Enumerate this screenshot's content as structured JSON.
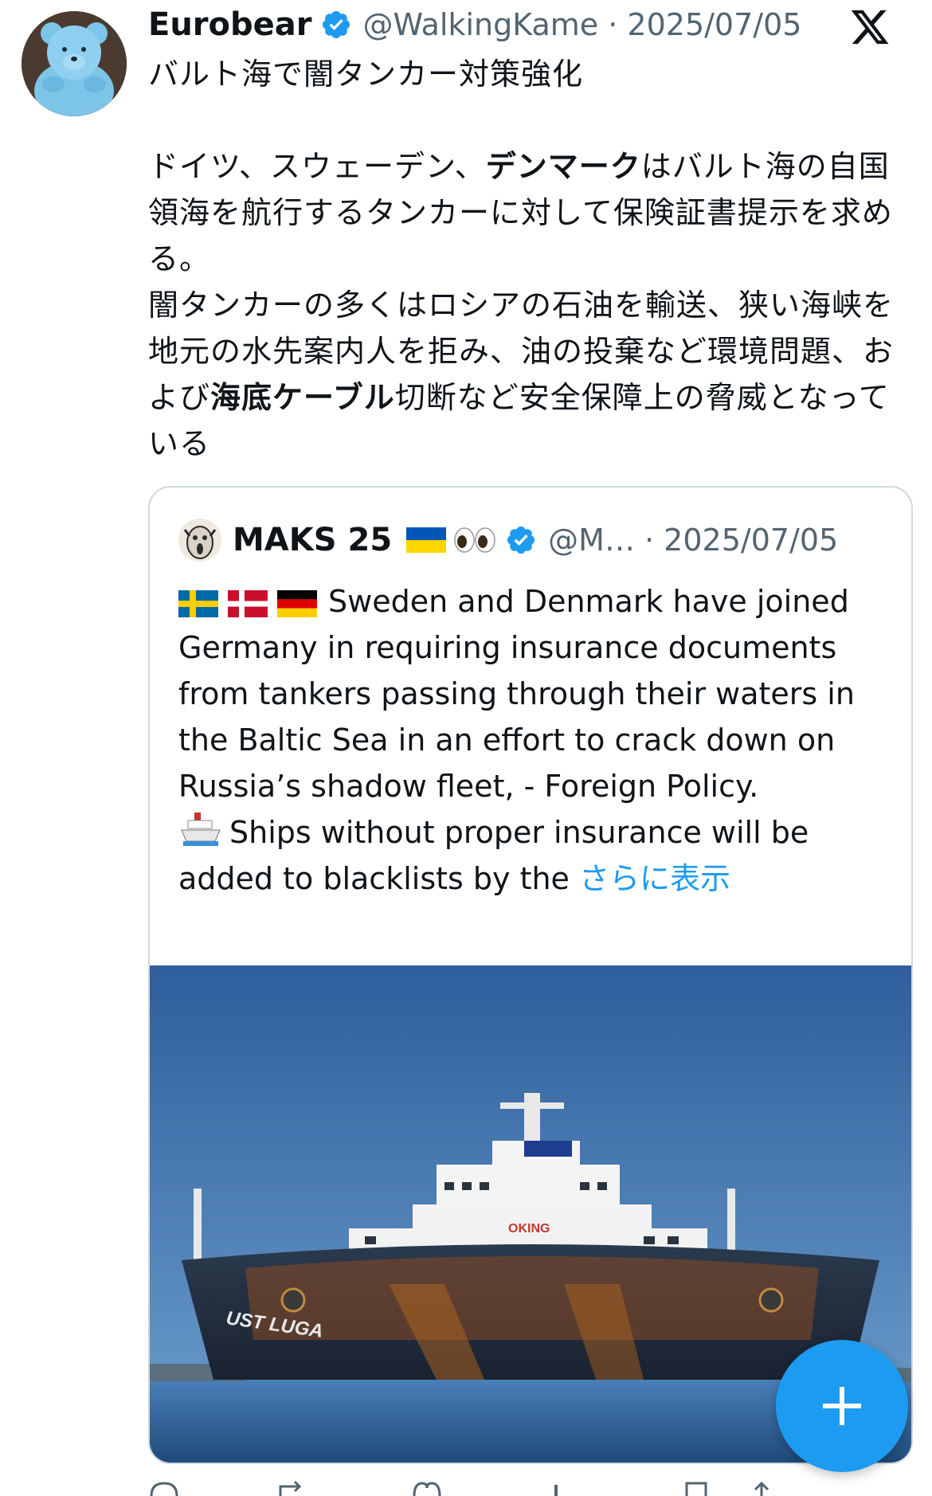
{
  "tweet": {
    "display_name": "Eurobear",
    "handle_date": "@WalkingKame · 2025/07/05",
    "title_line": "バルト海で闇タンカー対策強化",
    "para1_pre": "ドイツ、スウェーデン、",
    "para1_bold": "デンマーク",
    "para1_post": "はバルト海の自国領海を航行するタンカーに対して保険証書提示を求める。",
    "para2_pre": "闇タンカーの多くはロシアの石油を輸送、狭い海峡を地元の水先案内人を拒み、油の投棄など環境問題、および",
    "para2_bold": "海底ケーブル",
    "para2_post": "切断など安全保障上の脅威となっている"
  },
  "quote": {
    "display_name": "MAKS 25",
    "handle_date": "@M… · 2025/07/05",
    "line1": "Sweden and Denmark have joined Germany in requiring insurance documents from tankers passing through their waters in the Baltic Sea in an effort to crack down on Russia’s shadow fleet, - Foreign Policy.",
    "line2": "Ships without proper insurance will be added to blacklists by the",
    "show_more": "さらに表示",
    "image_ship_lettering": "UST LUGA",
    "image_superstructure_lettering": "OKING"
  },
  "icons": {
    "x_logo": "x-logo-icon",
    "verified": "verified-badge-icon",
    "compose": "plus-icon"
  },
  "colors": {
    "accent": "#1d9bf0",
    "text": "#0f1419",
    "secondary": "#536471",
    "border": "#cfd9de"
  }
}
